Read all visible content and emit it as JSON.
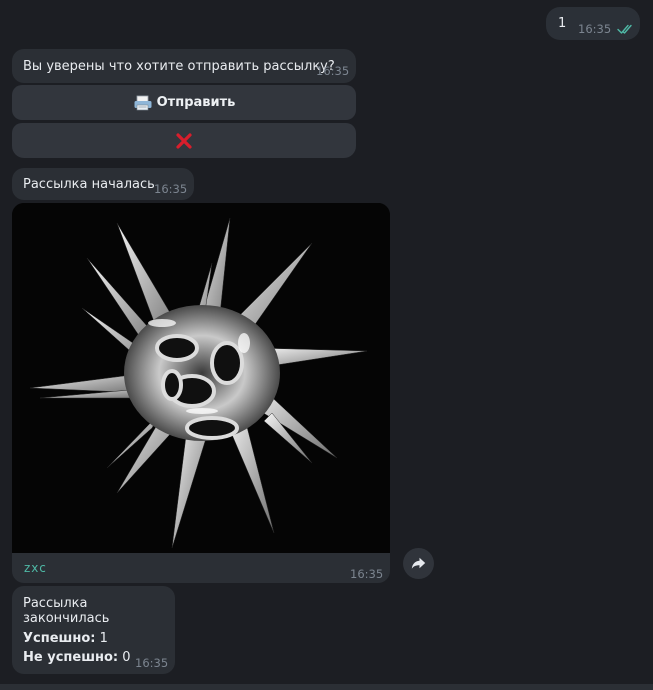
{
  "colors": {
    "background": "#1c1e23",
    "bubble": "#2b2f35",
    "keyboard_button": "#32363d",
    "time": "#7c8590",
    "read_check": "#4fb9a6",
    "caption": "#4fb9a6",
    "cancel_cross": "#d81e2c"
  },
  "outgoing": {
    "text": "1",
    "time": "16:35",
    "status_icon": "double-check-icon"
  },
  "confirm": {
    "text": "Вы уверены что хотите отправить рассылку?",
    "time": "16:35",
    "buttons": [
      {
        "icon": "printer-icon",
        "label": "Отправить"
      },
      {
        "icon": "red-cross-icon",
        "label": ""
      }
    ]
  },
  "started": {
    "text": "Рассылка началась",
    "time": "16:35"
  },
  "media": {
    "image": "chrome-spiky-sculpture-image",
    "caption": "zxc",
    "time": "16:35",
    "forward_icon": "forward-arrow-icon"
  },
  "finished": {
    "line1": "Рассылка закончилась",
    "success_label": "Успешно:",
    "success_value": " 1",
    "fail_label": "Не успешно:",
    "fail_value": " 0",
    "time": "16:35"
  }
}
